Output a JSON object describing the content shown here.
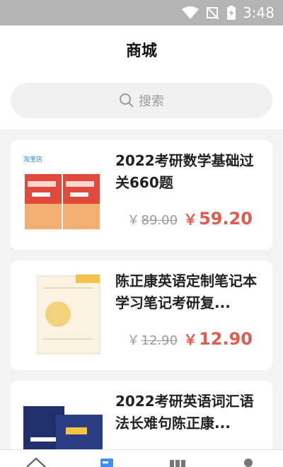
{
  "status": {
    "time": "3:48"
  },
  "header": {
    "title": "商城"
  },
  "search": {
    "placeholder": "搜索"
  },
  "products": [
    {
      "name": "2022考研数学基础过关660题",
      "old_price": "89.00",
      "new_price": "59.20",
      "currency": "￥"
    },
    {
      "name": "陈正康英语定制笔记本学习笔记考研复...",
      "old_price": "12.90",
      "new_price": "12.90",
      "currency": "￥"
    },
    {
      "name": "2022考研英语词汇语法长难句陈正康...",
      "old_price": "",
      "new_price": "",
      "currency": "￥"
    }
  ],
  "tabs": [
    {
      "icon": "home-icon",
      "active": false
    },
    {
      "icon": "store-icon",
      "active": true
    },
    {
      "icon": "books-icon",
      "active": false
    },
    {
      "icon": "profile-icon",
      "active": false
    }
  ],
  "colors": {
    "accent": "#3f8ef3",
    "price": "#e25b4f"
  }
}
